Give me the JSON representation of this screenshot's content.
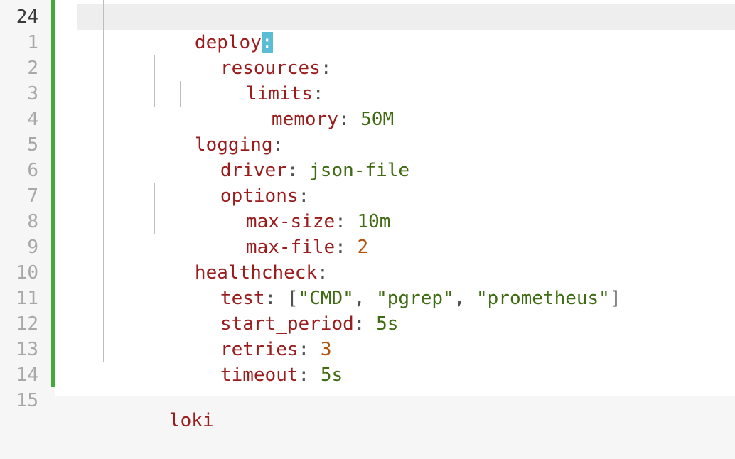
{
  "editor": {
    "current_line_number": "24",
    "line_numbers": [
      "1",
      "2",
      "3",
      "4",
      "5",
      "6",
      "7",
      "8",
      "9",
      "10",
      "11",
      "12",
      "13",
      "14",
      "15"
    ],
    "lines": [
      {
        "key": "deploy",
        "sep": ":",
        "cursor_on_sep": true
      },
      {
        "key": "resources",
        "sep": ":"
      },
      {
        "key": "limits",
        "sep": ":"
      },
      {
        "key": "memory",
        "sep": ": ",
        "value": "50M",
        "value_type": "str"
      },
      {
        "key": "logging",
        "sep": ":"
      },
      {
        "key": "driver",
        "sep": ": ",
        "value": "json-file",
        "value_type": "str"
      },
      {
        "key": "options",
        "sep": ":"
      },
      {
        "key": "max-size",
        "sep": ": ",
        "value": "10m",
        "value_type": "str"
      },
      {
        "key": "max-file",
        "sep": ": ",
        "value": "2",
        "value_type": "num"
      },
      {
        "key": "healthcheck",
        "sep": ":"
      },
      {
        "key": "test",
        "sep": ": ",
        "array": [
          "\"CMD\"",
          "\"pgrep\"",
          "\"prometheus\""
        ]
      },
      {
        "key": "start_period",
        "sep": ": ",
        "value": "5s",
        "value_type": "str"
      },
      {
        "key": "retries",
        "sep": ": ",
        "value": "3",
        "value_type": "num"
      },
      {
        "key": "timeout",
        "sep": ": ",
        "value": "5s",
        "value_type": "str"
      }
    ],
    "cut_off_bottom_text": "loki",
    "colors": {
      "key": "#9b1c1c",
      "string": "#3f6b12",
      "number": "#b5530e",
      "git_added": "#43a93a",
      "cursor": "#5bbcd6"
    }
  }
}
